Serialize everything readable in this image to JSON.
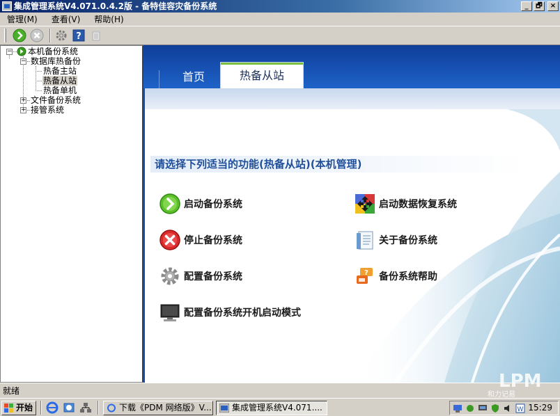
{
  "window": {
    "title": "集成管理系统V4.071.0.4.2版  - 备特佳容灾备份系统",
    "controls": {
      "minimize": "_",
      "restore": "🗗",
      "close": "×"
    }
  },
  "menu": {
    "items": [
      "管理(M)",
      "查看(V)",
      "帮助(H)"
    ]
  },
  "toolbar": {
    "icons": [
      "start-green-icon",
      "stop-gray-icon",
      "gear-icon",
      "help-icon",
      "trash-icon"
    ]
  },
  "tree": {
    "root": "本机备份系统",
    "db_hot_backup": "数据库热备份",
    "hot_master": "热备主站",
    "hot_slave": "热备从站",
    "hot_single": "热备单机",
    "file_backup": "文件备份系统",
    "managed": "接管系统",
    "selected": "热备从站"
  },
  "tabs": {
    "home": "首页",
    "active": "热备从站"
  },
  "main": {
    "header": "请选择下列适当的功能(热备从站)(本机管理)",
    "functions": {
      "start_backup": "启动备份系统",
      "start_recovery": "启动数据恢复系统",
      "stop_backup": "停止备份系统",
      "about_backup": "关于备份系统",
      "config_backup": "配置备份系统",
      "backup_help": "备份系统帮助",
      "config_boot_mode": "配置备份系统开机启动模式"
    }
  },
  "status": {
    "text": "就绪"
  },
  "taskbar": {
    "start": "开始",
    "tasks": [
      "下载《PDM 网络版》V...",
      "集成管理系统V4.071...."
    ],
    "clock": "15:29"
  },
  "watermark": {
    "brand": "LPM",
    "sub": "和力记易"
  },
  "colors": {
    "title_gradient_start": "#0a246a",
    "accent_blue": "#1a4fa8",
    "header_text": "#1f4f9a",
    "tab_green": "#7fbf40"
  }
}
